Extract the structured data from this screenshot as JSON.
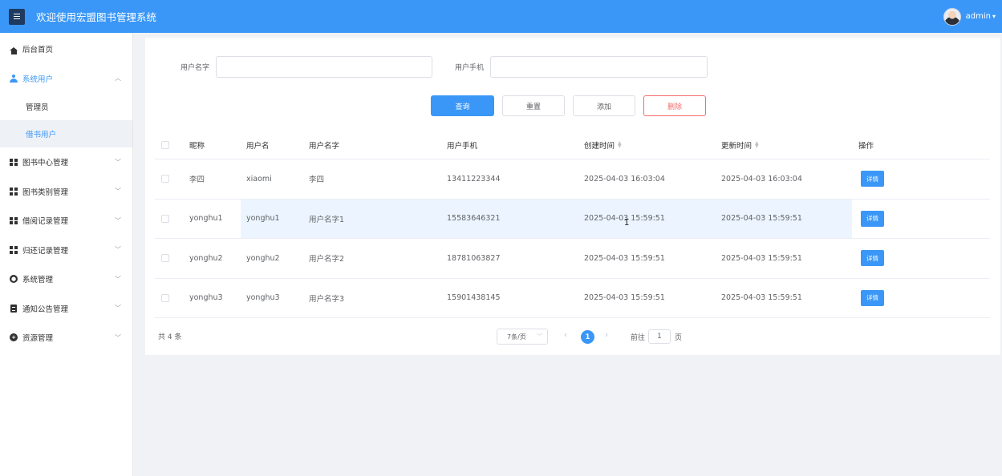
{
  "header": {
    "title": "欢迎使用宏盟图书管理系统",
    "user": "admin",
    "brand_color": "#3a97f7"
  },
  "sidebar": {
    "items": [
      {
        "label": "后台首页",
        "icon": "home-icon"
      },
      {
        "label": "系统用户",
        "icon": "user-icon",
        "expanded": true,
        "children": [
          {
            "label": "管理员"
          },
          {
            "label": "借书用户",
            "active": true
          }
        ]
      },
      {
        "label": "图书中心管理",
        "icon": "grid-icon"
      },
      {
        "label": "图书类别管理",
        "icon": "grid-icon"
      },
      {
        "label": "借阅记录管理",
        "icon": "grid-icon"
      },
      {
        "label": "归还记录管理",
        "icon": "grid-icon"
      },
      {
        "label": "系统管理",
        "icon": "gear-icon"
      },
      {
        "label": "通知公告管理",
        "icon": "document-icon"
      },
      {
        "label": "资源管理",
        "icon": "plus-circle-icon"
      }
    ]
  },
  "search": {
    "name_label": "用户名字",
    "name_value": "",
    "phone_label": "用户手机",
    "phone_value": "",
    "buttons": {
      "query": "查询",
      "reset": "重置",
      "add": "添加",
      "delete": "删除"
    }
  },
  "table": {
    "columns": [
      "昵称",
      "用户名",
      "用户名字",
      "用户手机",
      "创建时间",
      "更新时间",
      "操作"
    ],
    "rows": [
      {
        "nickname": "李四",
        "username": "xiaomi",
        "realname": "李四",
        "phone": "13411223344",
        "created": "2025-04-03 16:03:04",
        "updated": "2025-04-03 16:03:04",
        "action": "详情"
      },
      {
        "nickname": "yonghu1",
        "username": "yonghu1",
        "realname": "用户名字1",
        "phone": "15583646321",
        "created": "2025-04-03 15:59:51",
        "updated": "2025-04-03 15:59:51",
        "action": "详情"
      },
      {
        "nickname": "yonghu2",
        "username": "yonghu2",
        "realname": "用户名字2",
        "phone": "18781063827",
        "created": "2025-04-03 15:59:51",
        "updated": "2025-04-03 15:59:51",
        "action": "详情"
      },
      {
        "nickname": "yonghu3",
        "username": "yonghu3",
        "realname": "用户名字3",
        "phone": "15901438145",
        "created": "2025-04-03 15:59:51",
        "updated": "2025-04-03 15:59:51",
        "action": "详情"
      }
    ]
  },
  "pagination": {
    "total": "共 4 条",
    "page_size": "7条/页",
    "current_page": "1",
    "goto_prefix": "前往",
    "goto_value": "1",
    "goto_suffix": "页"
  }
}
